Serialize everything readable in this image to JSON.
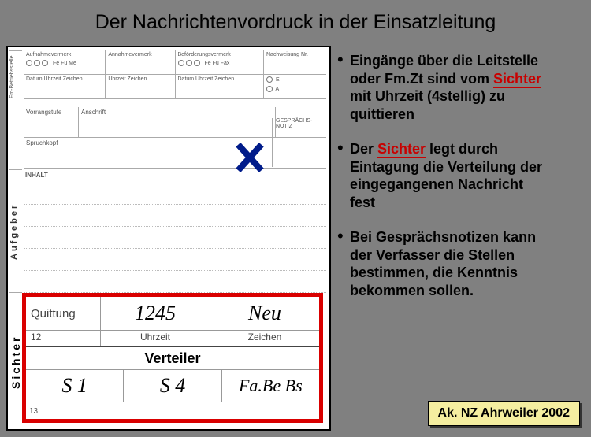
{
  "title": "Der Nachrichtenvordruck in der Einsatzleitung",
  "form": {
    "side_labels": {
      "fm": "Fm-Betriebsstelle",
      "aufgeber": "Aufgeber",
      "sichter": "Sichter"
    },
    "top": {
      "c1": "Aufnahmevermerk",
      "c1_sub": "Fe  Fu  Me",
      "c2": "Annahmevermerk",
      "c3": "Beförderungsvermerk",
      "c3_sub": "Fe  Fu  Fax",
      "c4": "Nachweisung Nr."
    },
    "row2": {
      "c1": "Datum  Uhrzeit  Zeichen",
      "c2": "Uhrzeit  Zeichen",
      "c3": "Datum  Uhrzeit  Zeichen",
      "ea": "E",
      "eb": "A"
    },
    "row3": {
      "c1": "Vorrangstufe",
      "c2": "Anschrift",
      "c3_a": "GESPRÄCHS-",
      "c3_b": "NOTIZ"
    },
    "spruchkopf": "Spruchkopf",
    "inhalt": "INHALT",
    "lower": {
      "quittung": "Quittung",
      "time": "1245",
      "sign": "Neu",
      "num12": "12",
      "uhrzeit": "Uhrzeit",
      "zeichen": "Zeichen",
      "verteiler": "Verteiler",
      "d1": "S 1",
      "d2": "S 4",
      "d3": "Fa.Be Bs",
      "num13": "13"
    }
  },
  "bullets": {
    "b1_lead": "Eingänge über die Leitstelle",
    "b1_cont": "oder Fm.Zt sind vom ",
    "b1_key": "Sichter",
    "b1_tail1": "mit Uhrzeit (4stellig) zu",
    "b1_tail2": "quittieren",
    "b2_pre": "Der ",
    "b2_key": "Sichter",
    "b2_post": " legt durch",
    "b2_cont1": "Eintagung die Verteilung der",
    "b2_cont2": "eingegangenen Nachricht",
    "b2_cont3": "fest",
    "b3_lead": "Bei Gesprächsnotizen kann",
    "b3_c1": "der Verfasser die Stellen",
    "b3_c2": "bestimmen, die Kenntnis",
    "b3_c3": "bekommen sollen."
  },
  "footer": "Ak. NZ Ahrweiler 2002"
}
